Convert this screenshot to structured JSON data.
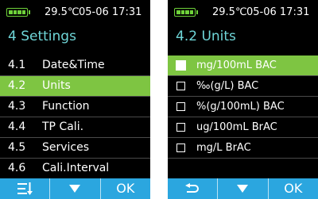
{
  "status": {
    "temperature": "29.5℃",
    "datetime": "05-06 17:31"
  },
  "left": {
    "title": "4 Settings",
    "items": [
      {
        "num": "4.1",
        "label": "Date&Time"
      },
      {
        "num": "4.2",
        "label": "Units"
      },
      {
        "num": "4.3",
        "label": "Function"
      },
      {
        "num": "4.4",
        "label": "TP Cali."
      },
      {
        "num": "4.5",
        "label": "Services"
      },
      {
        "num": "4.6",
        "label": "Cali.Interval"
      }
    ],
    "selected_index": 1,
    "buttons": {
      "left_icon": "menu-down-icon",
      "middle_icon": "arrow-down-icon",
      "ok": "OK"
    }
  },
  "right": {
    "title": "4.2 Units",
    "units": [
      {
        "label": "mg/100mL  BAC",
        "checked": true
      },
      {
        "label": "‰(g/L)  BAC",
        "checked": false
      },
      {
        "label": "%(g/100mL)  BAC",
        "checked": false
      },
      {
        "label": "ug/100mL  BrAC",
        "checked": false
      },
      {
        "label": "mg/L  BrAC",
        "checked": false
      }
    ],
    "selected_index": 0,
    "buttons": {
      "left_icon": "return-icon",
      "middle_icon": "arrow-down-icon",
      "ok": "OK"
    }
  },
  "colors": {
    "accent_green": "#7ec542",
    "title_cyan": "#6fd6d8",
    "button_blue": "#2ba6df"
  }
}
